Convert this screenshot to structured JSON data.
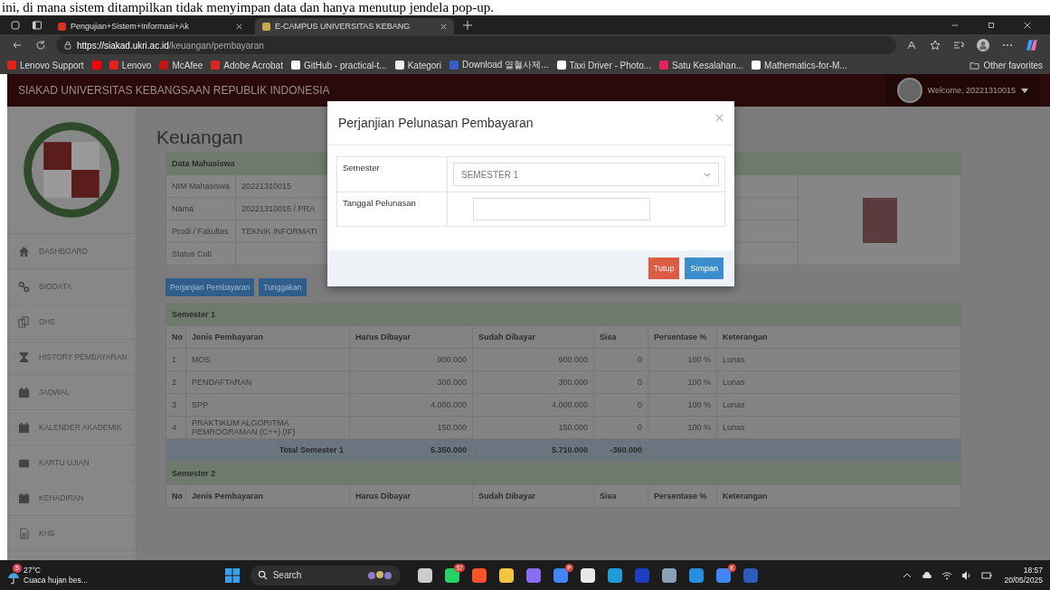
{
  "document_text": "ini, di mana sistem ditampilkan tidak menyimpan data dan hanya menutup jendela pop-up.",
  "browser": {
    "tabs": [
      {
        "label": "Pengujian+Sistem+Informasi+Ak",
        "selected": false
      },
      {
        "label": "E-CAMPUS UNIVERSITAS KEBANG",
        "selected": true
      }
    ],
    "url_host": "https://siakad.ukri.ac.id",
    "url_path": "/keuangan/pembayaran",
    "bookmarks": [
      {
        "label": "Lenovo Support",
        "kind": "lenovo"
      },
      {
        "kind": "youtube"
      },
      {
        "label": "Lenovo",
        "kind": "lenovo"
      },
      {
        "label": "McAfee",
        "kind": "shield"
      },
      {
        "label": "Adobe Acrobat",
        "kind": "acrobat"
      },
      {
        "label": "GitHub - practical-t...",
        "kind": "github"
      },
      {
        "label": "Kategori",
        "kind": "v"
      },
      {
        "label": "Download 열혈사제...",
        "kind": "globe"
      },
      {
        "label": "Taxi Driver - Photo...",
        "kind": "flag"
      },
      {
        "label": "Satu Kesalahan...",
        "kind": "youtube-dot"
      },
      {
        "label": "Mathematics-for-M...",
        "kind": "github"
      }
    ],
    "other_favorites": "Other favorites"
  },
  "header": {
    "title": "SIAKAD UNIVERSITAS KEBANGSAAN REPUBLIK INDONESIA",
    "welcome": "Welcome, 20221310015"
  },
  "sidebar": {
    "items": [
      {
        "label": "DASHBOARD"
      },
      {
        "label": "BIODATA"
      },
      {
        "label": "DHS"
      },
      {
        "label": "HISTORY PEMBAYARAN"
      },
      {
        "label": "JADWAL"
      },
      {
        "label": "KALENDER AKADEMIK"
      },
      {
        "label": "KARTU UJIAN"
      },
      {
        "label": "KEHADIRAN"
      },
      {
        "label": "KHS"
      }
    ]
  },
  "page_title": "Keuangan",
  "student": {
    "heading": "Data Mahasiswa",
    "rows": [
      {
        "label": "NIM Mahasiswa",
        "value": "20221310015"
      },
      {
        "label": "Nama",
        "value": "20221310015 / PRA"
      },
      {
        "label": "Prodi / Fakultas",
        "value": "TEKNIK INFORMATI"
      },
      {
        "label": "Status Cuti",
        "value": ""
      }
    ]
  },
  "actions": [
    "Perjanjian Pembayaran",
    "Tunggakan"
  ],
  "semesters": [
    {
      "title": "Semester 1",
      "columns": [
        "No",
        "Jenis Pembayaran",
        "Harus Dibayar",
        "Sudah Dibayar",
        "Sisa",
        "Persentase %",
        "Keterangan"
      ],
      "rows": [
        {
          "no": "1",
          "name": "MOS",
          "due": "900.000",
          "paid": "900.000",
          "rest": "0",
          "pct": "100 %",
          "note": "Lunas"
        },
        {
          "no": "2",
          "name": "PENDAFTARAN",
          "due": "300.000",
          "paid": "300.000",
          "rest": "0",
          "pct": "100 %",
          "note": "Lunas"
        },
        {
          "no": "3",
          "name": "SPP",
          "due": "4.000.000",
          "paid": "4.000.000",
          "rest": "0",
          "pct": "100 %",
          "note": "Lunas"
        },
        {
          "no": "4",
          "name": "PRAKTIKUM ALGORITMA PEMROGRAMAN (C++) (IF)",
          "due": "150.000",
          "paid": "150.000",
          "rest": "0",
          "pct": "100 %",
          "note": "Lunas"
        }
      ],
      "total": {
        "label": "Total Semester 1",
        "due": "5.350.000",
        "paid": "5.710.000",
        "rest": "-360.000"
      }
    },
    {
      "title": "Semester 2",
      "columns": [
        "No",
        "Jenis Pembayaran",
        "Harus Dibayar",
        "Sudah Dibayar",
        "Sisa",
        "Persentase %",
        "Keterangan"
      ]
    }
  ],
  "modal": {
    "title": "Perjanjian Pelunasan Pembayaran",
    "fields": [
      {
        "label": "Semester",
        "kind": "select",
        "value": "SEMESTER 1"
      },
      {
        "label": "Tanggal Pelunasan",
        "kind": "text"
      }
    ],
    "buttons": [
      {
        "label": "Tutup",
        "kind": "danger"
      },
      {
        "label": "Simpan",
        "kind": "primary"
      }
    ]
  },
  "taskbar": {
    "weather_badge": "5",
    "temperature": "27°C",
    "weather": "Cuaca hujan bes...",
    "search": "Search",
    "apps": [
      {
        "kind": "taskview"
      },
      {
        "kind": "chat",
        "badge": "57"
      },
      {
        "kind": "brave"
      },
      {
        "kind": "folder"
      },
      {
        "kind": "copilot"
      },
      {
        "kind": "chrome",
        "badge": "P"
      },
      {
        "kind": "store"
      },
      {
        "kind": "edge"
      },
      {
        "kind": "l-app"
      },
      {
        "kind": "gear"
      },
      {
        "kind": "vscode"
      },
      {
        "kind": "chrome",
        "badge": "K"
      },
      {
        "kind": "word"
      }
    ],
    "time": "18:57",
    "date": "20/05/2025"
  }
}
